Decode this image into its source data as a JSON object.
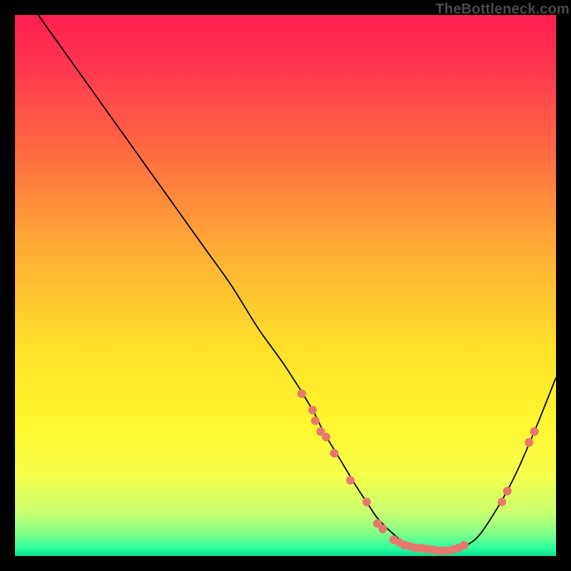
{
  "watermark": "TheBottleneck.com",
  "chart_data": {
    "type": "line",
    "title": "",
    "xlabel": "",
    "ylabel": "",
    "xlim": [
      0,
      100
    ],
    "ylim": [
      0,
      100
    ],
    "grid": false,
    "legend": false,
    "series": [
      {
        "name": "curve",
        "x": [
          0,
          5,
          10,
          15,
          20,
          25,
          30,
          35,
          40,
          45,
          50,
          55,
          57,
          60,
          63,
          65,
          67,
          70,
          72,
          75,
          78,
          80,
          82,
          85,
          88,
          92,
          96,
          100
        ],
        "y": [
          106,
          99,
          92,
          85,
          78,
          71,
          64,
          57,
          50,
          42,
          35,
          27,
          23,
          18,
          13,
          10,
          7,
          4,
          2.5,
          1.5,
          1,
          1,
          1.5,
          3,
          7,
          14,
          23,
          33
        ],
        "color": "#000000",
        "linewidth": 1.8
      }
    ],
    "markers": [
      {
        "name": "dots",
        "color": "#e8776c",
        "radius": 6,
        "points": [
          {
            "x": 53,
            "y": 30
          },
          {
            "x": 55,
            "y": 27
          },
          {
            "x": 55.5,
            "y": 25
          },
          {
            "x": 56.5,
            "y": 23
          },
          {
            "x": 57.5,
            "y": 22
          },
          {
            "x": 59,
            "y": 19
          },
          {
            "x": 62,
            "y": 14
          },
          {
            "x": 65,
            "y": 10
          },
          {
            "x": 67,
            "y": 6
          },
          {
            "x": 68,
            "y": 5
          },
          {
            "x": 70,
            "y": 3
          },
          {
            "x": 71,
            "y": 2.5
          },
          {
            "x": 72,
            "y": 2
          },
          {
            "x": 73,
            "y": 1.8
          },
          {
            "x": 74,
            "y": 1.5
          },
          {
            "x": 75,
            "y": 1.5
          },
          {
            "x": 76,
            "y": 1.3
          },
          {
            "x": 77,
            "y": 1.2
          },
          {
            "x": 78,
            "y": 1
          },
          {
            "x": 79,
            "y": 1
          },
          {
            "x": 80,
            "y": 1
          },
          {
            "x": 81,
            "y": 1.2
          },
          {
            "x": 82,
            "y": 1.5
          },
          {
            "x": 83,
            "y": 2
          },
          {
            "x": 90,
            "y": 10
          },
          {
            "x": 91,
            "y": 12
          },
          {
            "x": 95,
            "y": 21
          },
          {
            "x": 96,
            "y": 23
          }
        ]
      }
    ],
    "background": {
      "stops": [
        {
          "offset": 0.0,
          "color": "#ff2050"
        },
        {
          "offset": 0.1,
          "color": "#ff3850"
        },
        {
          "offset": 0.25,
          "color": "#ff6a42"
        },
        {
          "offset": 0.45,
          "color": "#ffb234"
        },
        {
          "offset": 0.62,
          "color": "#ffe12a"
        },
        {
          "offset": 0.75,
          "color": "#fff62e"
        },
        {
          "offset": 0.85,
          "color": "#f6ff4a"
        },
        {
          "offset": 0.92,
          "color": "#c8ff70"
        },
        {
          "offset": 0.96,
          "color": "#7fff8a"
        },
        {
          "offset": 0.985,
          "color": "#2cff9c"
        },
        {
          "offset": 1.0,
          "color": "#0adf90"
        }
      ]
    }
  }
}
